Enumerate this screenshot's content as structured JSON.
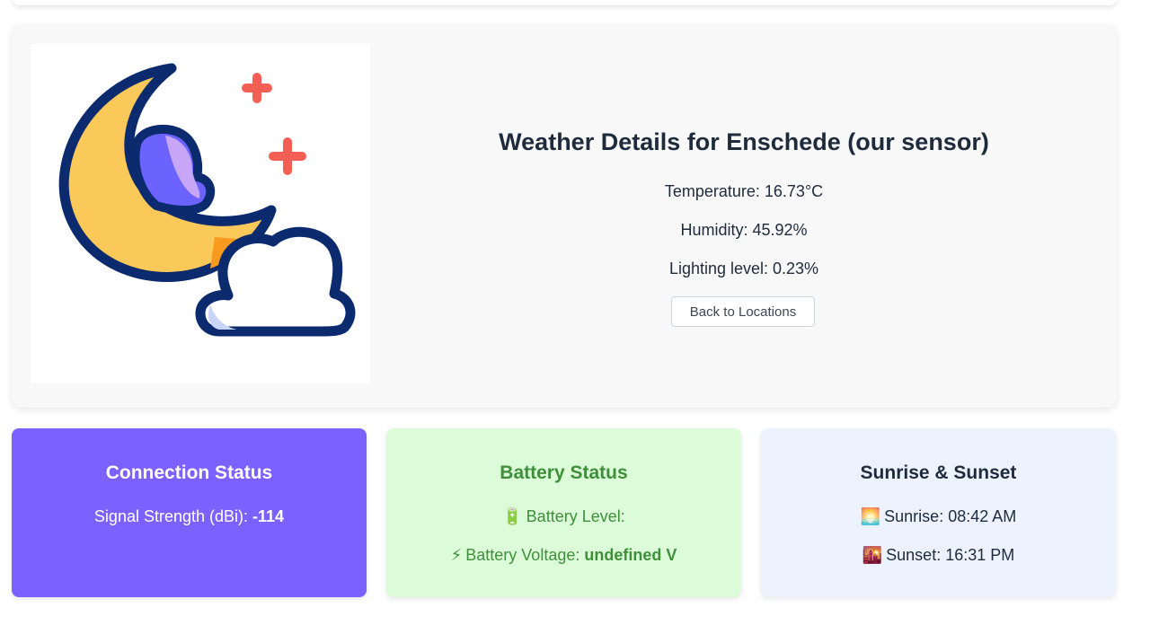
{
  "weather": {
    "title": "Weather Details for Enschede (our sensor)",
    "temperature": "Temperature: 16.73°C",
    "humidity": "Humidity: 45.92%",
    "lighting": "Lighting level: 0.23%",
    "back_button": "Back to Locations",
    "icon": "moon-cloud-stars-icon"
  },
  "connection": {
    "title": "Connection Status",
    "signal_label": "Signal Strength (dBi): ",
    "signal_value": "-114"
  },
  "battery": {
    "title": "Battery Status",
    "level_icon": "🔋",
    "level_label": "Battery Level:",
    "voltage_icon": "⚡",
    "voltage_label": "Battery Voltage: ",
    "voltage_value": "undefined V"
  },
  "sun": {
    "title": "Sunrise & Sunset",
    "sunrise_icon": "🌅",
    "sunrise": "Sunrise: 08:42 AM",
    "sunset_icon": "🌇",
    "sunset": "Sunset: 16:31 PM"
  },
  "colors": {
    "connection_bg": "#7b61ff",
    "battery_bg": "#dcfcd9",
    "sun_bg": "#edf3fe",
    "moon": "#fbc85a",
    "outline": "#0c2a6e",
    "star": "#f45f55"
  }
}
